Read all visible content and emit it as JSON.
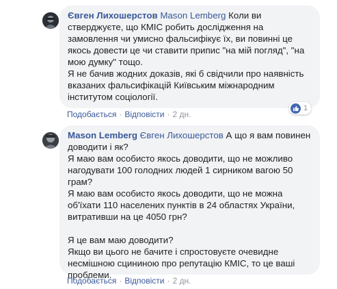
{
  "comments": [
    {
      "author": "Євген Лихошерстов",
      "mention": "Mason Lemberg",
      "lines": [
        "Коли ви",
        "стверджуєте, що КМІС робить дослідження на",
        "замовлення чи умисно фальсифікує їх, ви повинні це",
        "якось довести це чи ставити припис \"на мій погляд\", \"на",
        "мою думку\" тощо.",
        "Я не бачив жодних доказів, які б свідчили про наявність",
        "вказаних фальсифікацій Київським міжнародним",
        "інститутом соціології."
      ],
      "actions": {
        "like": "Подобається",
        "reply": "Відповісти",
        "time": "2 дн."
      },
      "reaction": {
        "icon": "like-icon",
        "count": "1",
        "color": "#4267b2"
      }
    },
    {
      "author": "Mason Lemberg",
      "mention": "Євген Лихошерстов",
      "lines": [
        "А що я вам повинен",
        "доводити і як?",
        "Я маю вам особисто якось доводити, що не можливо",
        "нагодувати 100 голодних людей 1 сирником вагою 50",
        "грам?",
        "Я маю вам особисто якось доводити, що не можна",
        "об'їхати 110 населених пунктів в 24 областях України,",
        "витративши на це 4050 грн?",
        "",
        "Я це вам маю доводити?",
        "Якщо ви цього не бачите і спростовуєте очевидне",
        "несмішною сцининою про репутацію КМІС, то це ваші",
        "проблеми."
      ],
      "actions": {
        "like": "Подобається",
        "reply": "Відповісти",
        "time": "2 дн."
      }
    }
  ],
  "colors": {
    "link": "#385898",
    "bubble": "#f2f3f5",
    "meta": "#90949c"
  }
}
